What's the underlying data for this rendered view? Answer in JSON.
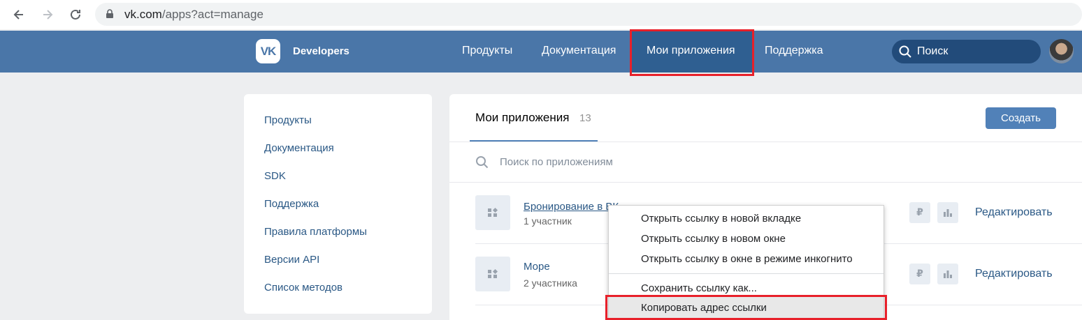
{
  "browser": {
    "url_host": "vk.com",
    "url_path": "/apps?act=manage"
  },
  "header": {
    "logo_text": "VK",
    "brand": "Developers",
    "nav": [
      "Продукты",
      "Документация",
      "Мои приложения",
      "Поддержка"
    ],
    "search_label": "Поиск"
  },
  "sidebar": {
    "items": [
      "Продукты",
      "Документация",
      "SDK",
      "Поддержка",
      "Правила платформы",
      "Версии API",
      "Список методов"
    ]
  },
  "main": {
    "tab_title": "Мои приложения",
    "tab_count": "13",
    "create_label": "Создать",
    "search_placeholder": "Поиск по приложениям",
    "apps": [
      {
        "name": "Бронирование в ВК",
        "members": "1 участник",
        "currency_icon": "₽",
        "edit_label": "Редактировать"
      },
      {
        "name": "Море",
        "members": "2 участника",
        "currency_icon": "₽",
        "edit_label": "Редактировать"
      }
    ]
  },
  "context_menu": {
    "items": [
      "Открыть ссылку в новой вкладке",
      "Открыть ссылку в новом окне",
      "Открыть ссылку в окне в режиме инкогнито",
      "Сохранить ссылку как...",
      "Копировать адрес ссылки"
    ]
  },
  "colors": {
    "header_bg": "#4a76a8",
    "active_tab_bg": "#2f5f91",
    "link": "#2a5885",
    "accent_button": "#5181b8",
    "highlight_box": "#e8202a"
  }
}
